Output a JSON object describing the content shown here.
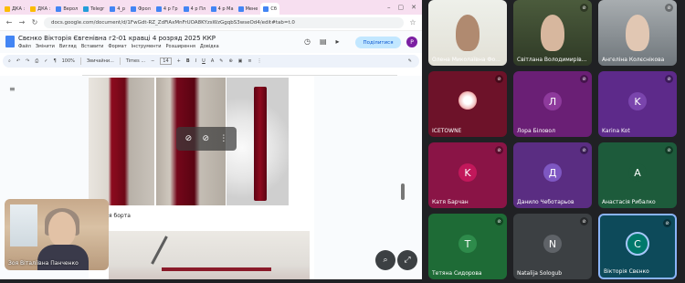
{
  "browser": {
    "tabs": [
      {
        "label": "ДКА :",
        "color": "#fbbc04"
      },
      {
        "label": "ДКА :",
        "color": "#fbbc04"
      },
      {
        "label": "Верол",
        "color": "#4285f4"
      },
      {
        "label": "Telegr",
        "color": "#229ed9"
      },
      {
        "label": "4_р",
        "color": "#4285f4"
      },
      {
        "label": "Фрол",
        "color": "#4285f4"
      },
      {
        "label": "4 р Гр",
        "color": "#4285f4"
      },
      {
        "label": "4 р Пл",
        "color": "#4285f4"
      },
      {
        "label": "4 р Ма",
        "color": "#4285f4"
      },
      {
        "label": "Мене",
        "color": "#4285f4"
      },
      {
        "label": "Сб",
        "color": "#4285f4",
        "active": true
      }
    ],
    "url": "docs.google.com/document/d/1FwGdt-RZ_ZdFiAxMnFrUOA8KYzsWzGgqbS3wseOd4/edit#tab=t.0"
  },
  "doc": {
    "title": "Свєнко Вікторія Євгенівна г2-01 кравці 4 розряд 2025 ККР",
    "menu": [
      "Файл",
      "Змінити",
      "Вигляд",
      "Вставити",
      "Формат",
      "Інструменти",
      "Розширення",
      "Довідка"
    ],
    "share_label": "Поділитися",
    "avatar_letter": "Р",
    "zoom": "100%",
    "style": "Звичайни...",
    "font": "Times ...",
    "font_size": "14",
    "caption": "я борта"
  },
  "selfview": {
    "name": "Зоя Віталіївна Панченко"
  },
  "participants": [
    {
      "name": "Олена Миколаївна Фо...",
      "type": "video",
      "muted": false
    },
    {
      "name": "Світлана Володимирів...",
      "type": "video",
      "muted": true
    },
    {
      "name": "Ангеліна Колєснікова",
      "type": "video",
      "muted": true
    },
    {
      "name": "ICETOWNE",
      "type": "image",
      "muted": true,
      "bg": "#6d1229"
    },
    {
      "name": "Лора Біловол",
      "initial": "Л",
      "muted": true,
      "bg": "#6a1f75",
      "circle": "#8e3a9c"
    },
    {
      "name": "Karina Kot",
      "initial": "K",
      "muted": true,
      "bg": "#5d2a8a",
      "circle": "#7a45ad"
    },
    {
      "name": "Катя Барчан",
      "initial": "K",
      "muted": true,
      "bg": "#8a1446",
      "circle": "#c2185b"
    },
    {
      "name": "Данило Чеботарьов",
      "initial": "Д",
      "muted": true,
      "bg": "#5a2d82",
      "circle": "#7e57c2"
    },
    {
      "name": "Анастасія Рибалко",
      "initial": "A",
      "muted": true,
      "bg": "#1d5b3b",
      "circle": "#1d5b3b"
    },
    {
      "name": "Тетяна Сидорова",
      "initial": "T",
      "muted": true,
      "bg": "#1e6b36",
      "circle": "#2e8b4b"
    },
    {
      "name": "Natalija Sologub",
      "initial": "N",
      "muted": true,
      "bg": "#3c4043",
      "circle": "#5f6368"
    },
    {
      "name": "Вікторія Свєнко",
      "initial": "C",
      "muted": true,
      "bg": "#0d4a5a",
      "circle": "#00796b",
      "highlight": true
    }
  ]
}
